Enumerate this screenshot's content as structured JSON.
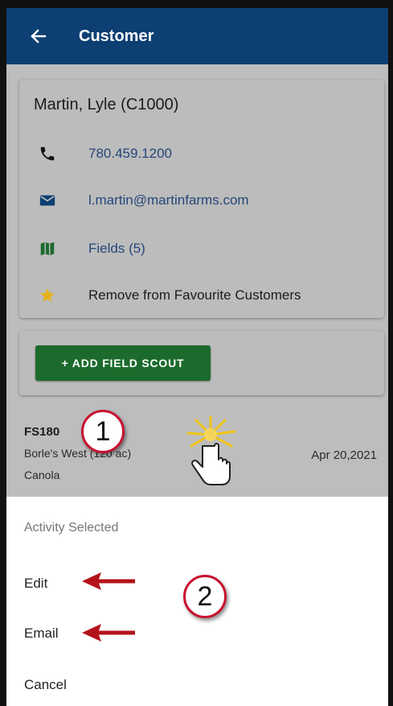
{
  "appbar": {
    "title": "Customer"
  },
  "customer": {
    "name": "Martin, Lyle (C1000)",
    "phone": "780.459.1200",
    "email": "l.martin@martinfarms.com",
    "fields": "Fields (5)",
    "favourite": "Remove from Favourite Customers"
  },
  "scout_button": {
    "label": "+ ADD FIELD SCOUT"
  },
  "activity": {
    "id": "FS180",
    "field": "Borle's West (120 ac)",
    "crop": "Canola",
    "date": "Apr 20,2021"
  },
  "sheet": {
    "title": "Activity Selected",
    "edit": "Edit",
    "email": "Email",
    "cancel": "Cancel"
  },
  "annotations": {
    "step1": "1",
    "step2": "2"
  },
  "colors": {
    "appbar": "#0d3f73",
    "button": "#1c6b2c",
    "link": "#25477a",
    "star": "#e5b21b",
    "arrow": "#b3121a"
  }
}
